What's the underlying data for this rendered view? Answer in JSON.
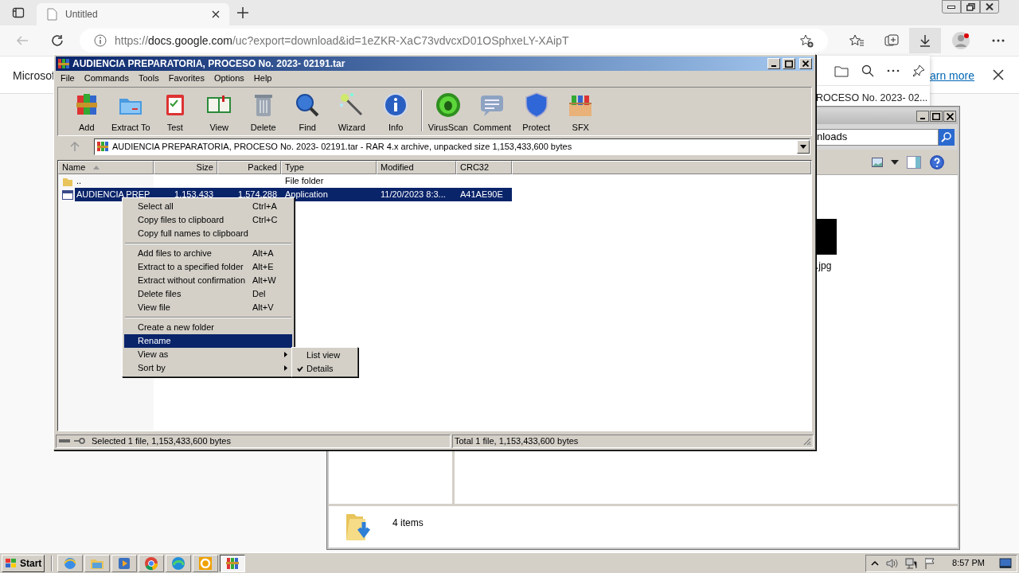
{
  "browser": {
    "tab": {
      "title": "Untitled"
    },
    "url": {
      "scheme": "https://",
      "host": "docs.google.com",
      "path": "/uc?export=download&id=1eZKR-XaC73vdvcxD01OSphxeLY-XAipT"
    },
    "page_text": "Microsof",
    "downloads_panel": {
      "item_text": "ROCESO No. 2023- 02..."
    },
    "learn_more_link": "arn more"
  },
  "explorer": {
    "address": "nloads",
    "file_name": ".jpg",
    "status": "4 items"
  },
  "winrar": {
    "title": "AUDIENCIA PREPARATORIA, PROCESO No. 2023- 02191.tar",
    "menu": [
      "File",
      "Commands",
      "Tools",
      "Favorites",
      "Options",
      "Help"
    ],
    "toolbar": [
      {
        "kind": "add",
        "label": "Add"
      },
      {
        "kind": "extract",
        "label": "Extract To"
      },
      {
        "kind": "test",
        "label": "Test"
      },
      {
        "kind": "view",
        "label": "View"
      },
      {
        "kind": "delete",
        "label": "Delete"
      },
      {
        "kind": "find",
        "label": "Find"
      },
      {
        "kind": "wizard",
        "label": "Wizard"
      },
      {
        "kind": "info",
        "label": "Info"
      },
      {
        "kind": "virusscan",
        "label": "VirusScan"
      },
      {
        "kind": "comment",
        "label": "Comment"
      },
      {
        "kind": "protect",
        "label": "Protect"
      },
      {
        "kind": "sfx",
        "label": "SFX"
      }
    ],
    "path": "AUDIENCIA PREPARATORIA, PROCESO No. 2023- 02191.tar - RAR 4.x archive, unpacked size 1,153,433,600 bytes",
    "columns": [
      {
        "label": "Name",
        "sorted": true
      },
      {
        "label": "Size",
        "sorted": false
      },
      {
        "label": "Packed",
        "sorted": false
      },
      {
        "label": "Type",
        "sorted": false
      },
      {
        "label": "Modified",
        "sorted": false
      },
      {
        "label": "CRC32",
        "sorted": false
      }
    ],
    "rows": [
      {
        "kind": "folder",
        "name": "..",
        "type": "File folder",
        "selected": false
      },
      {
        "kind": "file",
        "name": "AUDIENCIA PREP",
        "size": "1,153,433",
        "packed": "1,574,288",
        "type": "Application",
        "modified": "11/20/2023 8:3...",
        "crc32": "A41AE90E",
        "selected": true
      }
    ],
    "status_left": "Selected 1 file, 1,153,433,600 bytes",
    "status_right": "Total 1 file, 1,153,433,600 bytes"
  },
  "context_menu": {
    "groups": [
      [
        {
          "label": "Select all",
          "shortcut": "Ctrl+A",
          "selected": false,
          "submenu": false
        },
        {
          "label": "Copy files to clipboard",
          "shortcut": "Ctrl+C",
          "selected": false,
          "submenu": false
        },
        {
          "label": "Copy full names to clipboard",
          "selected": false,
          "submenu": false
        }
      ],
      [
        {
          "label": "Add files to archive",
          "shortcut": "Alt+A",
          "selected": false,
          "submenu": false
        },
        {
          "label": "Extract to a specified folder",
          "shortcut": "Alt+E",
          "selected": false,
          "submenu": false
        },
        {
          "label": "Extract without confirmation",
          "shortcut": "Alt+W",
          "selected": false,
          "submenu": false
        },
        {
          "label": "Delete files",
          "shortcut": "Del",
          "selected": false,
          "submenu": false
        },
        {
          "label": "View file",
          "shortcut": "Alt+V",
          "selected": false,
          "submenu": false
        }
      ],
      [
        {
          "label": "Create a new folder",
          "selected": false,
          "submenu": false
        },
        {
          "label": "Rename",
          "selected": true,
          "submenu": false
        },
        {
          "label": "View as",
          "selected": false,
          "submenu": true
        },
        {
          "label": "Sort by",
          "selected": false,
          "submenu": true
        }
      ]
    ],
    "submenu": [
      {
        "label": "List view",
        "checked": false
      },
      {
        "label": "Details",
        "checked": true
      }
    ]
  },
  "taskbar": {
    "start": "Start",
    "apps": [
      {
        "kind": "globe",
        "selected": false
      },
      {
        "kind": "folder",
        "selected": false
      },
      {
        "kind": "player",
        "selected": false
      },
      {
        "kind": "ring",
        "selected": false
      },
      {
        "kind": "swirl",
        "selected": false
      },
      {
        "kind": "office",
        "selected": false
      },
      {
        "kind": "archive",
        "selected": true
      }
    ],
    "clock": "8:57 PM"
  }
}
